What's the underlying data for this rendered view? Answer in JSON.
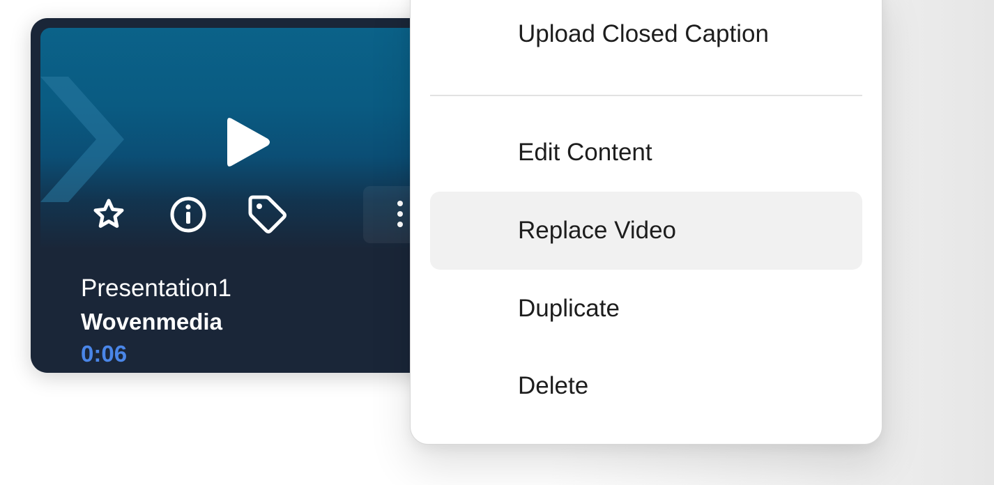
{
  "card": {
    "title": "Presentation1",
    "owner": "Wovenmedia",
    "duration": "0:06",
    "icons": {
      "play": "play-icon",
      "favorite": "star-icon",
      "info": "info-icon",
      "tags": "tag-icon",
      "more": "more-vertical-icon"
    },
    "colors": {
      "card_background": "#1a2638",
      "thumbnail_blue": "#0b6289",
      "duration_text": "#4a86e8"
    }
  },
  "menu": {
    "items": [
      {
        "label": "Upload Closed Caption"
      },
      {
        "label": "Edit Content"
      },
      {
        "label": "Replace Video",
        "highlighted": true
      },
      {
        "label": "Duplicate"
      },
      {
        "label": "Delete"
      }
    ],
    "colors": {
      "background": "#ffffff",
      "highlight": "#f1f1f1",
      "text": "#1d1d1d"
    }
  }
}
